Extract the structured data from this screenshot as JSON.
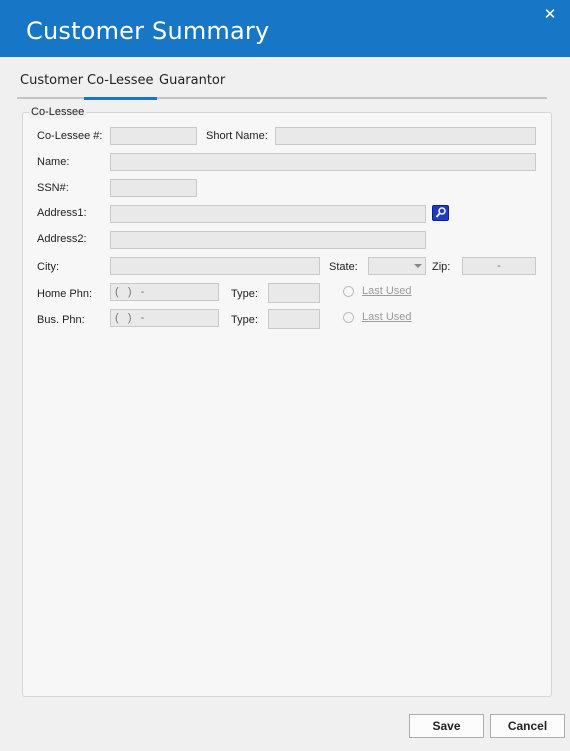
{
  "window": {
    "title": "Customer Summary",
    "close_glyph": "✕"
  },
  "tabs": [
    {
      "label": "Customer"
    },
    {
      "label": "Co-Lessee",
      "active": true
    },
    {
      "label": "Guarantor"
    }
  ],
  "group": {
    "legend": "Co-Lessee"
  },
  "labels": {
    "colessee_no": "Co-Lessee #:",
    "short_name": "Short Name:",
    "name": "Name:",
    "ssn": "SSN#:",
    "address1": "Address1:",
    "address2": "Address2:",
    "city": "City:",
    "state": "State:",
    "zip": "Zip:",
    "home_phn": "Home Phn:",
    "bus_phn": "Bus. Phn:",
    "type": "Type:",
    "last_used": "Last Used"
  },
  "fields": {
    "colessee_no": "",
    "short_name": "",
    "name": "",
    "ssn": "",
    "address1": "",
    "address2": "",
    "city": "",
    "state": "",
    "zip": "-",
    "home_phn": "(   )   -",
    "home_type": "",
    "bus_phn": "(   )   -",
    "bus_type": ""
  },
  "buttons": {
    "save": "Save",
    "cancel": "Cancel"
  },
  "icons": {
    "lookup": "search-icon",
    "accent": "#1777c6"
  }
}
